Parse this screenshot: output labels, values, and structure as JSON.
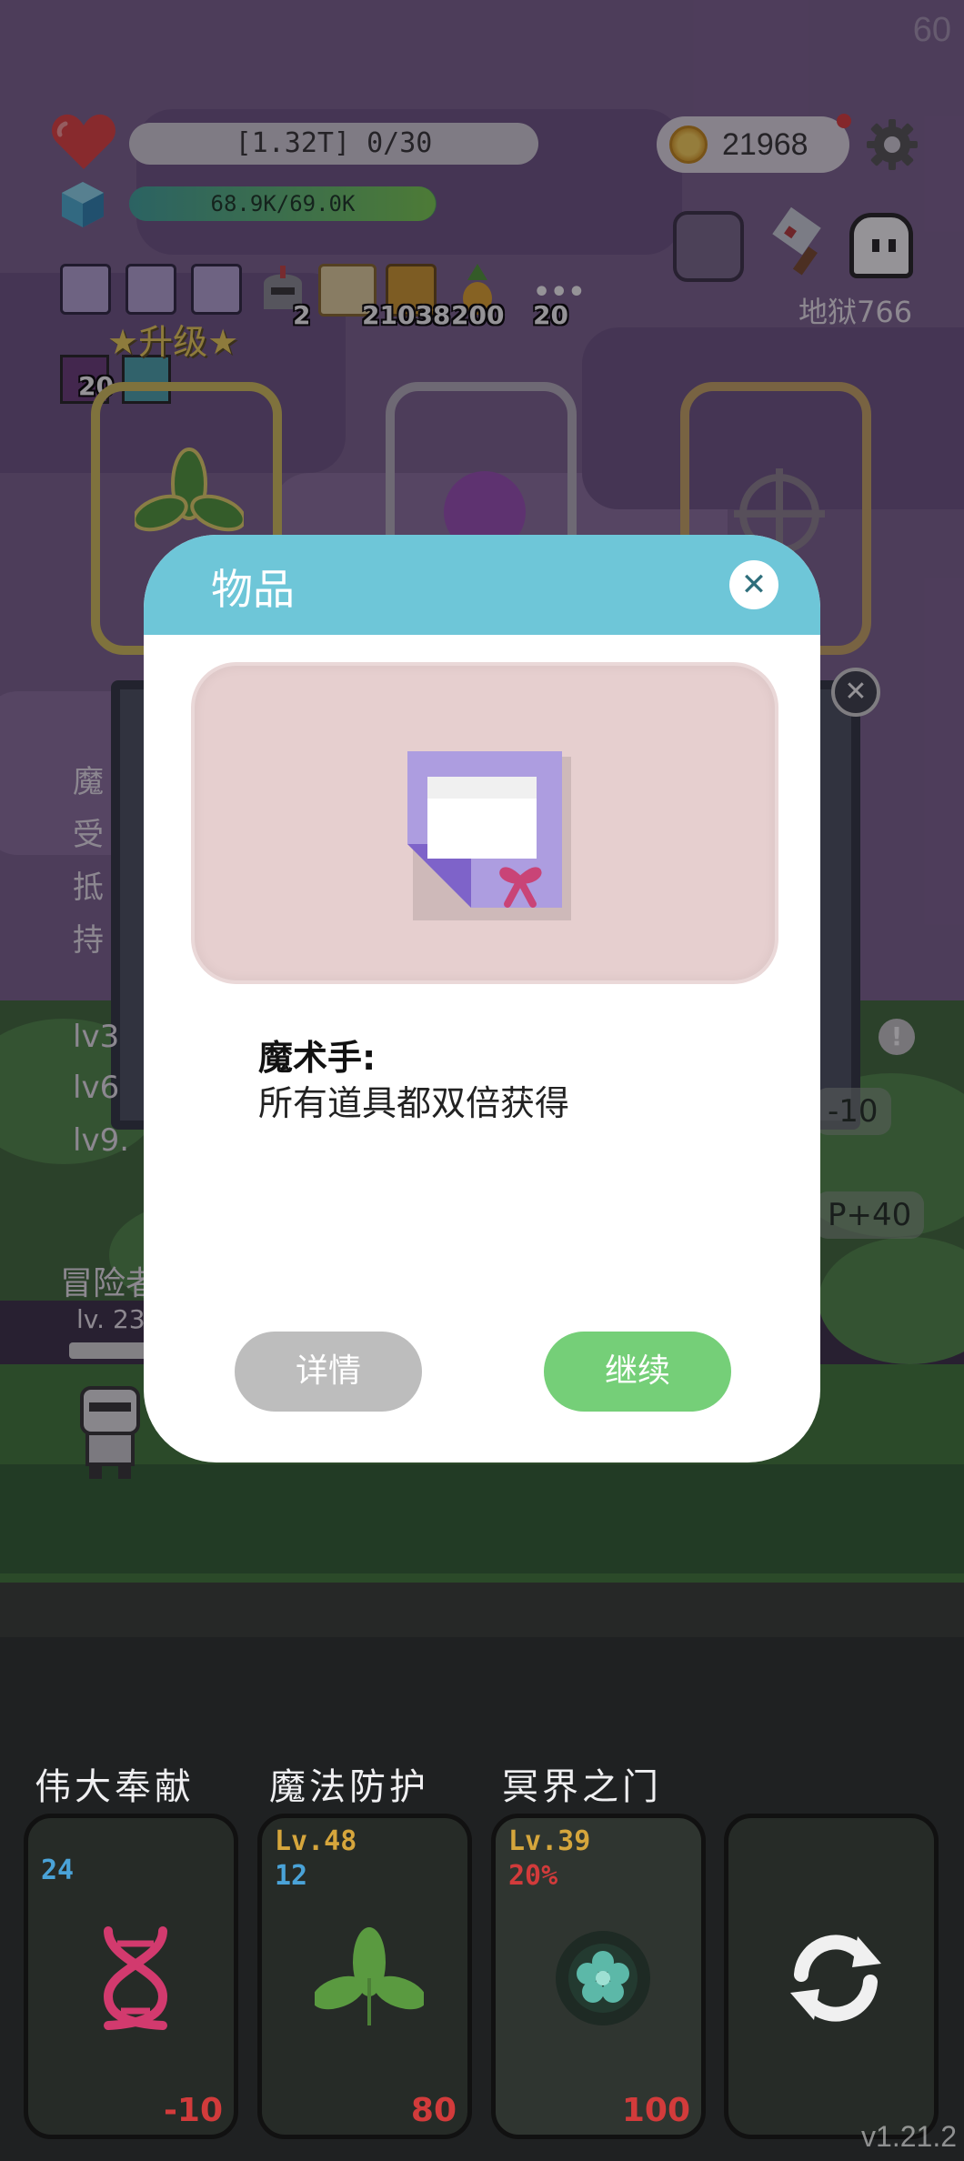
{
  "hud": {
    "fps": "60",
    "hp_text": "[1.32T] 0/30",
    "mp_text": "68.9K/69.0K",
    "mp_fraction": 0.998,
    "gold": "21968",
    "hell_stage": "地狱766",
    "upgrade_label": "★升级★"
  },
  "inventory": {
    "counts": [
      "2",
      "21038",
      "200",
      "20",
      "20"
    ]
  },
  "background_panel": {
    "left_chars": [
      "魔",
      "受",
      "抵",
      "持"
    ],
    "levels": [
      "lv3",
      "lv6",
      "lv9."
    ],
    "pill_1": "-10",
    "pill_2": "P+40",
    "hero_label": "冒险者",
    "hero_level": "lv. 23"
  },
  "modal": {
    "title": "物品",
    "item_name": "魔术手:",
    "item_desc": "所有道具都双倍获得",
    "detail_button": "详情",
    "continue_button": "继续"
  },
  "skills": [
    {
      "name": "伟大奉献",
      "lv": "",
      "sub": "24",
      "sub_color": "#4aa3d8",
      "bottom": "-10",
      "icon": "dna-icon"
    },
    {
      "name": "魔法防护",
      "lv": "Lv.48",
      "sub": "12",
      "sub_color": "#4aa3d8",
      "bottom": "80",
      "icon": "leaf-icon"
    },
    {
      "name": "冥界之门",
      "lv": "Lv.39",
      "sub": "20%",
      "sub_color": "#d23b3b",
      "bottom": "100",
      "icon": "portal-icon"
    },
    {
      "name": "",
      "lv": "",
      "sub": "",
      "bottom": "",
      "icon": "refresh-icon"
    }
  ],
  "version": "v1.21.2"
}
